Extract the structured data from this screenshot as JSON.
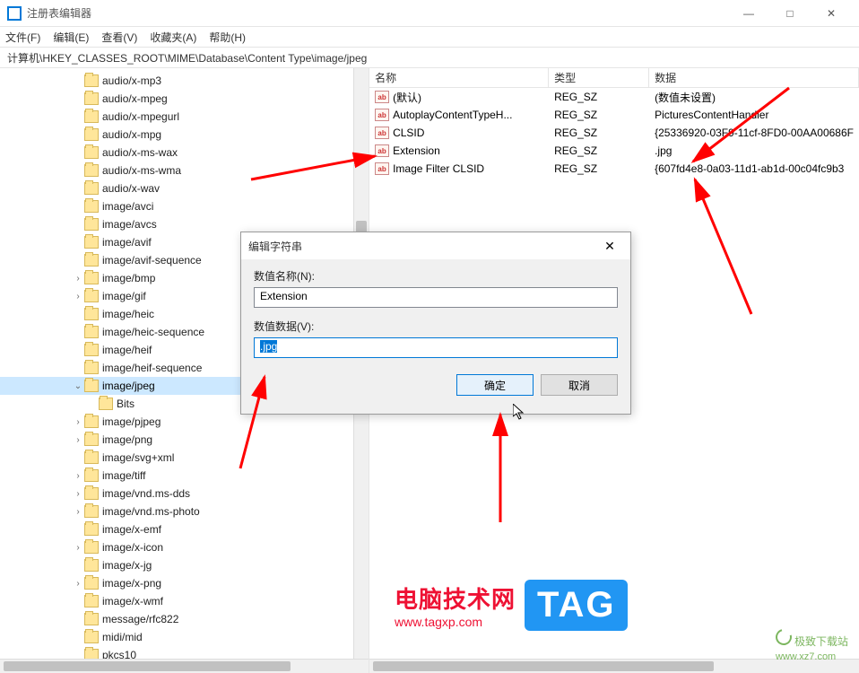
{
  "window": {
    "title": "注册表编辑器",
    "minimize": "—",
    "maximize": "□",
    "close": "✕"
  },
  "menu": {
    "file": "文件(F)",
    "edit": "编辑(E)",
    "view": "查看(V)",
    "favorites": "收藏夹(A)",
    "help": "帮助(H)"
  },
  "address": "计算机\\HKEY_CLASSES_ROOT\\MIME\\Database\\Content Type\\image/jpeg",
  "tree": [
    {
      "indent": 5,
      "label": "audio/x-mp3",
      "expander": ""
    },
    {
      "indent": 5,
      "label": "audio/x-mpeg",
      "expander": ""
    },
    {
      "indent": 5,
      "label": "audio/x-mpegurl",
      "expander": ""
    },
    {
      "indent": 5,
      "label": "audio/x-mpg",
      "expander": ""
    },
    {
      "indent": 5,
      "label": "audio/x-ms-wax",
      "expander": ""
    },
    {
      "indent": 5,
      "label": "audio/x-ms-wma",
      "expander": ""
    },
    {
      "indent": 5,
      "label": "audio/x-wav",
      "expander": ""
    },
    {
      "indent": 5,
      "label": "image/avci",
      "expander": ""
    },
    {
      "indent": 5,
      "label": "image/avcs",
      "expander": ""
    },
    {
      "indent": 5,
      "label": "image/avif",
      "expander": ""
    },
    {
      "indent": 5,
      "label": "image/avif-sequence",
      "expander": ""
    },
    {
      "indent": 5,
      "label": "image/bmp",
      "expander": ">"
    },
    {
      "indent": 5,
      "label": "image/gif",
      "expander": ">"
    },
    {
      "indent": 5,
      "label": "image/heic",
      "expander": ""
    },
    {
      "indent": 5,
      "label": "image/heic-sequence",
      "expander": ""
    },
    {
      "indent": 5,
      "label": "image/heif",
      "expander": ""
    },
    {
      "indent": 5,
      "label": "image/heif-sequence",
      "expander": ""
    },
    {
      "indent": 5,
      "label": "image/jpeg",
      "expander": "v",
      "selected": true
    },
    {
      "indent": 6,
      "label": "Bits",
      "expander": ""
    },
    {
      "indent": 5,
      "label": "image/pjpeg",
      "expander": ">"
    },
    {
      "indent": 5,
      "label": "image/png",
      "expander": ">"
    },
    {
      "indent": 5,
      "label": "image/svg+xml",
      "expander": ""
    },
    {
      "indent": 5,
      "label": "image/tiff",
      "expander": ">"
    },
    {
      "indent": 5,
      "label": "image/vnd.ms-dds",
      "expander": ">"
    },
    {
      "indent": 5,
      "label": "image/vnd.ms-photo",
      "expander": ">"
    },
    {
      "indent": 5,
      "label": "image/x-emf",
      "expander": ""
    },
    {
      "indent": 5,
      "label": "image/x-icon",
      "expander": ">"
    },
    {
      "indent": 5,
      "label": "image/x-jg",
      "expander": ""
    },
    {
      "indent": 5,
      "label": "image/x-png",
      "expander": ">"
    },
    {
      "indent": 5,
      "label": "image/x-wmf",
      "expander": ""
    },
    {
      "indent": 5,
      "label": "message/rfc822",
      "expander": ""
    },
    {
      "indent": 5,
      "label": "midi/mid",
      "expander": ""
    },
    {
      "indent": 5,
      "label": "pkcs10",
      "expander": ""
    }
  ],
  "list": {
    "headers": {
      "name": "名称",
      "type": "类型",
      "data": "数据"
    },
    "rows": [
      {
        "name": "(默认)",
        "type": "REG_SZ",
        "data": "(数值未设置)"
      },
      {
        "name": "AutoplayContentTypeH...",
        "type": "REG_SZ",
        "data": "PicturesContentHandler"
      },
      {
        "name": "CLSID",
        "type": "REG_SZ",
        "data": "{25336920-03F9-11cf-8FD0-00AA00686F"
      },
      {
        "name": "Extension",
        "type": "REG_SZ",
        "data": ".jpg"
      },
      {
        "name": "Image Filter CLSID",
        "type": "REG_SZ",
        "data": "{607fd4e8-0a03-11d1-ab1d-00c04fc9b3"
      }
    ]
  },
  "dialog": {
    "title": "编辑字符串",
    "close": "✕",
    "name_label": "数值名称(N):",
    "name_value": "Extension",
    "data_label": "数值数据(V):",
    "data_value": ".jpg",
    "ok": "确定",
    "cancel": "取消"
  },
  "watermark": {
    "text1": "电脑技术网",
    "text1_sub": "www.tagxp.com",
    "tag": "TAG",
    "text2": "极致下载站",
    "text2_sub": "www.xz7.com"
  }
}
